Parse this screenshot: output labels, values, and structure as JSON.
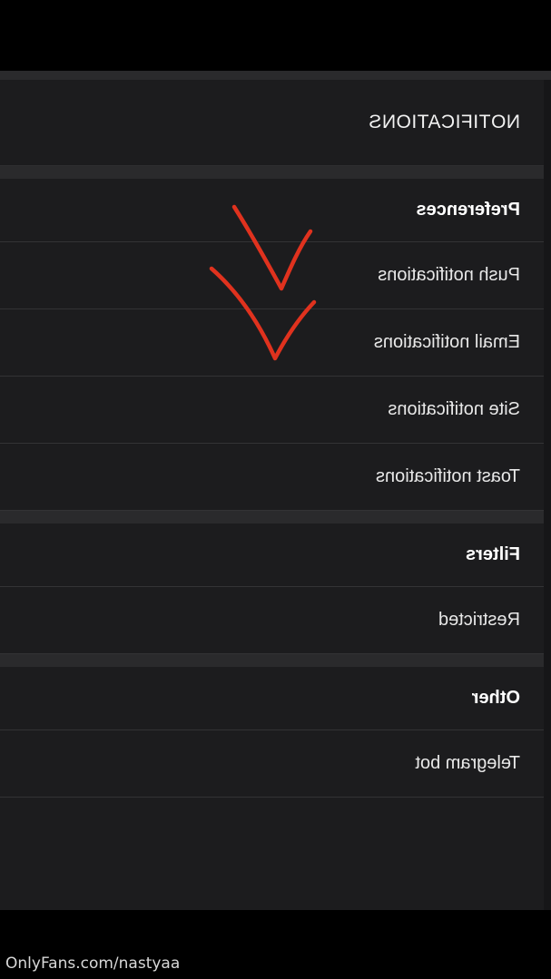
{
  "header": {
    "title": "NOTIFICATIONS"
  },
  "sections": [
    {
      "heading": "Preferences",
      "items": [
        "Push notifications",
        "Email notifications",
        "Site notifications",
        "Toast notifications"
      ]
    },
    {
      "heading": "Filters",
      "items": [
        "Restricted"
      ]
    },
    {
      "heading": "Other",
      "items": [
        "Telegram bot"
      ]
    }
  ],
  "annotation": {
    "checkmark_color": "#e0321e",
    "checked_items": [
      "Push notifications",
      "Email notifications"
    ]
  },
  "watermark": "OnlyFans.com/nastyaa",
  "colors": {
    "background": "#000000",
    "panel": "#1c1c1e",
    "divider": "#2a2a2c"
  }
}
